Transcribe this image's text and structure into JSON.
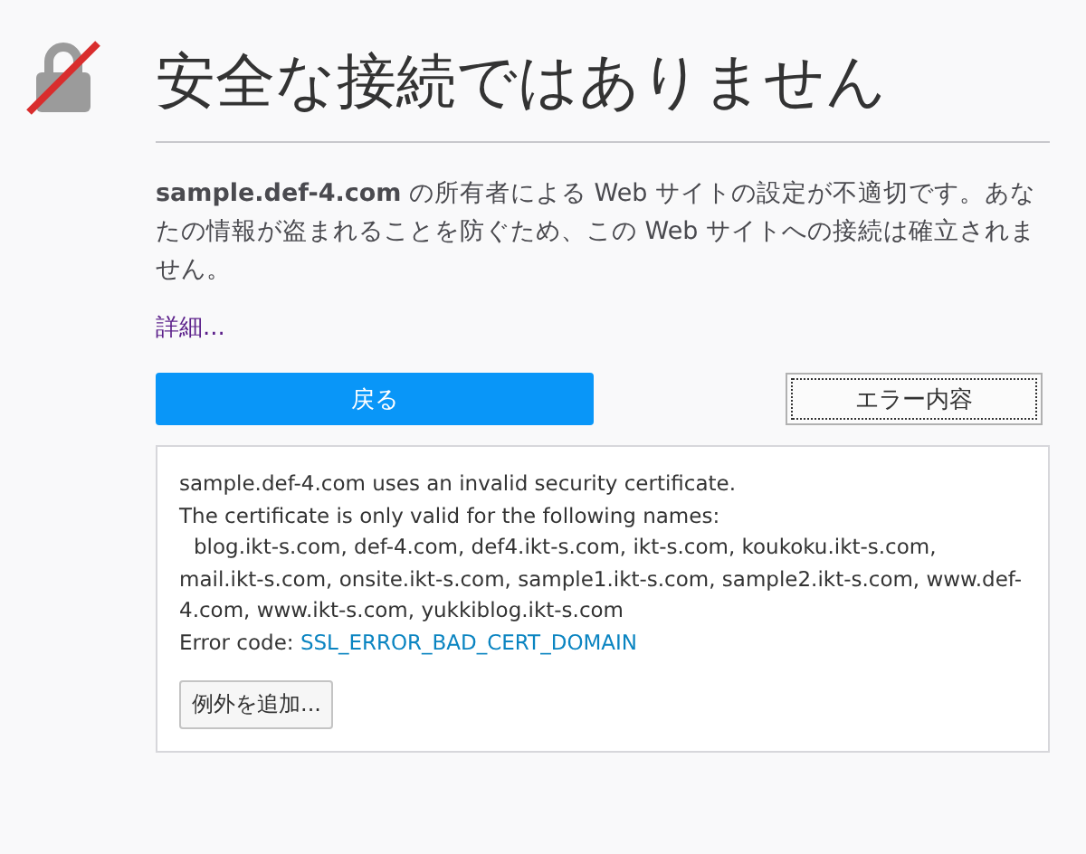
{
  "title": "安全な接続ではありません",
  "description": "**sample.def-4.com** の所有者による Web サイトの設定が不適切です。あなたの情報が盗まれることを防ぐため、この Web サイトへの接続は確立されません。",
  "details_link": "詳細...",
  "buttons": {
    "back": "戻る",
    "error_details": "エラー内容"
  },
  "details_panel": {
    "summary": "sample.def-4.com uses an invalid security certificate.",
    "names_heading": "The certificate is only valid for the following names:",
    "names": "blog.ikt-s.com, def-4.com, def4.ikt-s.com, ikt-s.com, koukoku.ikt-s.com, mail.ikt-s.com, onsite.ikt-s.com, sample1.ikt-s.com, sample2.ikt-s.com, www.def-4.com, www.ikt-s.com, yukkiblog.ikt-s.com",
    "error_code_label": "Error code:",
    "error_code": "SSL_ERROR_BAD_CERT_DOMAIN",
    "add_exception": "例外を追加..."
  }
}
